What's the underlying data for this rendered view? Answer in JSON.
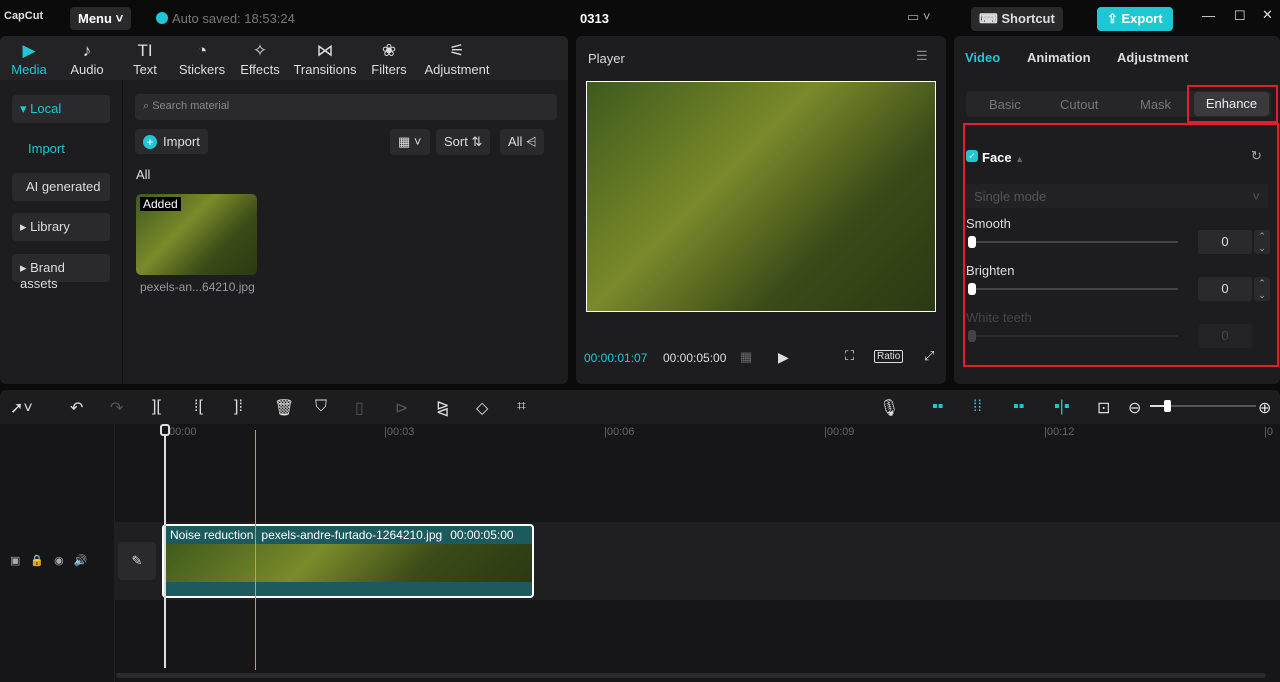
{
  "app": {
    "logo": "CapCut",
    "menu": "Menu",
    "autosave": "Auto saved: 18:53:24",
    "title": "0313",
    "shortcut": "Shortcut",
    "export": "Export"
  },
  "media_tabs": [
    {
      "label": "Media",
      "icon": "▶"
    },
    {
      "label": "Audio",
      "icon": "♪"
    },
    {
      "label": "Text",
      "icon": "TI"
    },
    {
      "label": "Stickers",
      "icon": "◔"
    },
    {
      "label": "Effects",
      "icon": "✧"
    },
    {
      "label": "Transitions",
      "icon": "⋈"
    },
    {
      "label": "Filters",
      "icon": "❀"
    },
    {
      "label": "Adjustment",
      "icon": "⚟"
    }
  ],
  "sidebar": {
    "local": "Local",
    "import": "Import",
    "ai": "AI generated",
    "library": "Library",
    "brand": "Brand assets"
  },
  "media": {
    "search_placeholder": "Search material",
    "import": "Import",
    "sort": "Sort",
    "all_filter": "All",
    "section": "All",
    "item_badge": "Added",
    "item_name": "pexels-an...64210.jpg"
  },
  "player": {
    "title": "Player",
    "current": "00:00:01:07",
    "total": "00:00:05:00",
    "ratio": "Ratio"
  },
  "right": {
    "tabs": [
      "Video",
      "Animation",
      "Adjustment"
    ],
    "subtabs": [
      "Basic",
      "Cutout",
      "Mask",
      "Enhance"
    ],
    "face": "Face",
    "mode": "Single mode",
    "smooth": "Smooth",
    "smooth_val": "0",
    "brighten": "Brighten",
    "brighten_val": "0",
    "teeth": "White teeth",
    "teeth_val": "0"
  },
  "timeline": {
    "ticks": [
      "00:00",
      "00:03",
      "00:06",
      "00:09",
      "00:12",
      "0"
    ],
    "clip_effect": "Noise reduction",
    "clip_name": "pexels-andre-furtado-1264210.jpg",
    "clip_duration": "00:00:05:00"
  },
  "colors": {
    "accent": "#1fc7d4",
    "highlight": "#e0202a",
    "clip": "#1d5a5e"
  }
}
